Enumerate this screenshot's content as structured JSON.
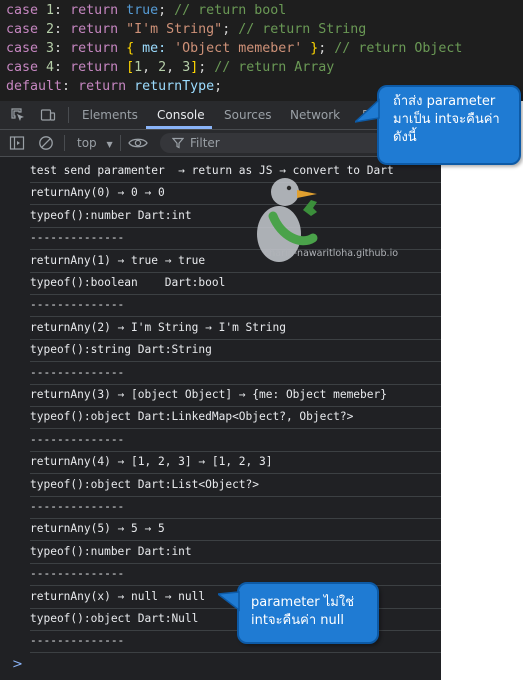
{
  "code_lines": [
    [
      {
        "t": "case ",
        "c": "kw"
      },
      {
        "t": "1",
        "c": "num"
      },
      {
        "t": ": ",
        "c": "pl"
      },
      {
        "t": "return ",
        "c": "kw"
      },
      {
        "t": "true",
        "c": "bool"
      },
      {
        "t": "; ",
        "c": "pl"
      },
      {
        "t": "// return bool",
        "c": "cm"
      }
    ],
    [
      {
        "t": "case ",
        "c": "kw"
      },
      {
        "t": "2",
        "c": "num"
      },
      {
        "t": ": ",
        "c": "pl"
      },
      {
        "t": "return ",
        "c": "kw"
      },
      {
        "t": "\"I'm String\"",
        "c": "str"
      },
      {
        "t": "; ",
        "c": "pl"
      },
      {
        "t": "// return String",
        "c": "cm"
      }
    ],
    [
      {
        "t": "case ",
        "c": "kw"
      },
      {
        "t": "3",
        "c": "num"
      },
      {
        "t": ": ",
        "c": "pl"
      },
      {
        "t": "return ",
        "c": "kw"
      },
      {
        "t": "{",
        "c": "br"
      },
      {
        "t": " me: ",
        "c": "fn"
      },
      {
        "t": "'Object memeber'",
        "c": "str"
      },
      {
        "t": " ",
        "c": "pl"
      },
      {
        "t": "}",
        "c": "br"
      },
      {
        "t": "; ",
        "c": "pl"
      },
      {
        "t": "// return Object",
        "c": "cm"
      }
    ],
    [
      {
        "t": "case ",
        "c": "kw"
      },
      {
        "t": "4",
        "c": "num"
      },
      {
        "t": ": ",
        "c": "pl"
      },
      {
        "t": "return ",
        "c": "kw"
      },
      {
        "t": "[",
        "c": "br"
      },
      {
        "t": "1",
        "c": "num"
      },
      {
        "t": ", ",
        "c": "pl"
      },
      {
        "t": "2",
        "c": "num"
      },
      {
        "t": ", ",
        "c": "pl"
      },
      {
        "t": "3",
        "c": "num"
      },
      {
        "t": "]",
        "c": "br"
      },
      {
        "t": "; ",
        "c": "pl"
      },
      {
        "t": "// return Array",
        "c": "cm"
      }
    ],
    [
      {
        "t": "default",
        "c": "kw"
      },
      {
        "t": ": ",
        "c": "pl"
      },
      {
        "t": "return ",
        "c": "kw"
      },
      {
        "t": "returnType",
        "c": "fn"
      },
      {
        "t": ";",
        "c": "pl"
      }
    ]
  ],
  "devtools": {
    "tabs": [
      "Elements",
      "Console",
      "Sources",
      "Network",
      "Pe"
    ],
    "active_tab": "Console",
    "context": "top",
    "filter_placeholder": "Filter"
  },
  "console_messages": [
    "test send paramenter  → return as JS → convert to Dart",
    "returnAny(0) → 0 → 0",
    "typeof():number Dart:int",
    "--------------",
    "returnAny(1) → true → true",
    "typeof():boolean    Dart:bool",
    "--------------",
    "returnAny(2) → I'm String → I'm String",
    "typeof():string Dart:String",
    "--------------",
    "returnAny(3) → [object Object] → {me: Object memeber}",
    "typeof():object Dart:LinkedMap<Object?, Object?>",
    "--------------",
    "returnAny(4) → [1, 2, 3] → [1, 2, 3]",
    "typeof():object Dart:List<Object?>",
    "--------------",
    "returnAny(5) → 5 → 5",
    "typeof():number Dart:int",
    "--------------",
    "returnAny(x) → null → null",
    "typeof():object Dart:Null",
    "--------------"
  ],
  "prompt_caret": ">",
  "callout_top": "ถ้าส่ง parameter มาเป็น intจะคืนค่าดังนี้",
  "callout_bottom": "parameter ไม่ใช่ intจะคืนค่า null",
  "watermark_text": "charin-nawaritloha.github.io"
}
